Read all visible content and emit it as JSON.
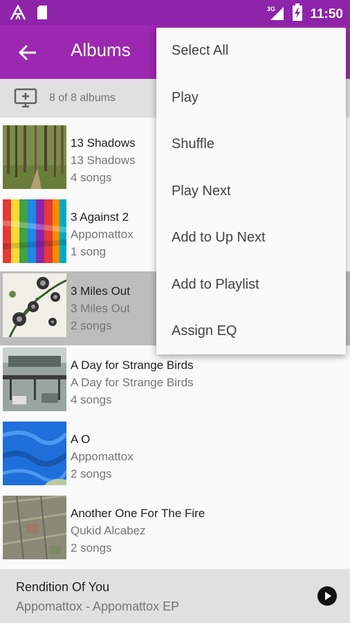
{
  "status_bar": {
    "time": "11:50",
    "signal_label": "3G"
  },
  "app_bar": {
    "title": "Albums"
  },
  "subheader": {
    "count_text": "8 of 8 albums"
  },
  "albums": [
    {
      "title": "13 Shadows",
      "artist": "13 Shadows",
      "songs": "4 songs"
    },
    {
      "title": "3 Against 2",
      "artist": "Appomattox",
      "songs": "1 song"
    },
    {
      "title": "3 Miles Out",
      "artist": "3 Miles Out",
      "songs": "2 songs"
    },
    {
      "title": "A Day for Strange Birds",
      "artist": "A Day for Strange Birds",
      "songs": "4 songs"
    },
    {
      "title": "A O",
      "artist": "Appomattox",
      "songs": "2 songs"
    },
    {
      "title": "Another One For The Fire",
      "artist": "Qukid Alcabez",
      "songs": "2 songs"
    }
  ],
  "menu": {
    "items": [
      "Select All",
      "Play",
      "Shuffle",
      "Play Next",
      "Add to Up Next",
      "Add to Playlist",
      "Assign EQ"
    ]
  },
  "now_playing": {
    "song": "Rendition Of You",
    "artist_album": "Appomattox - Appomattox EP"
  },
  "colors": {
    "status_bar": "#8e24aa",
    "app_bar": "#9c27b0",
    "selected_row": "#bdbdbd"
  }
}
